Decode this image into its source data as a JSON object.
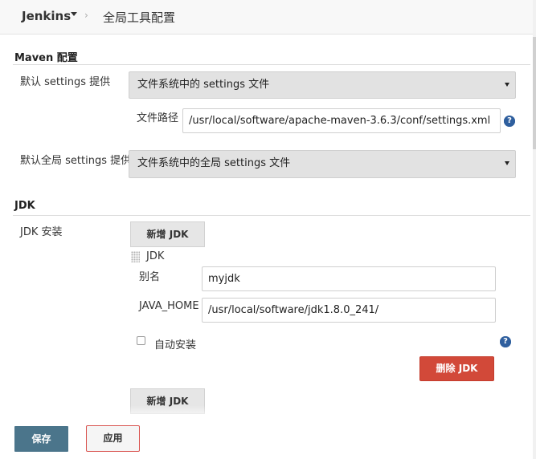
{
  "header": {
    "jenkins_label": "Jenkins",
    "page_title": "全局工具配置",
    "separator": "›"
  },
  "maven": {
    "section_title": "Maven 配置",
    "default_settings_label": "默认 settings 提供",
    "default_settings_value": "文件系统中的 settings 文件",
    "file_path_label": "文件路径",
    "file_path_value": "/usr/local/software/apache-maven-3.6.3/conf/settings.xml",
    "global_settings_label": "默认全局 settings 提供",
    "global_settings_value": "文件系统中的全局 settings 文件"
  },
  "jdk": {
    "section_title": "JDK",
    "install_label": "JDK 安装",
    "add_jdk_label": "新增 JDK",
    "entry_title": "JDK",
    "alias_label": "别名",
    "alias_value": "myjdk",
    "java_home_label": "JAVA_HOME",
    "java_home_value": "/usr/local/software/jdk1.8.0_241/",
    "auto_install_label": "自动安装",
    "auto_install_checked": false,
    "delete_jdk_label": "删除 JDK",
    "add_jdk_bottom_label": "新增 JDK"
  },
  "footer": {
    "save_label": "保存",
    "apply_label": "应用"
  },
  "icons": {
    "help": "?"
  },
  "colors": {
    "save_button": "#4b758b",
    "delete_button": "#d24939",
    "apply_border": "#d9534f",
    "help_icon": "#2f5f9e"
  }
}
